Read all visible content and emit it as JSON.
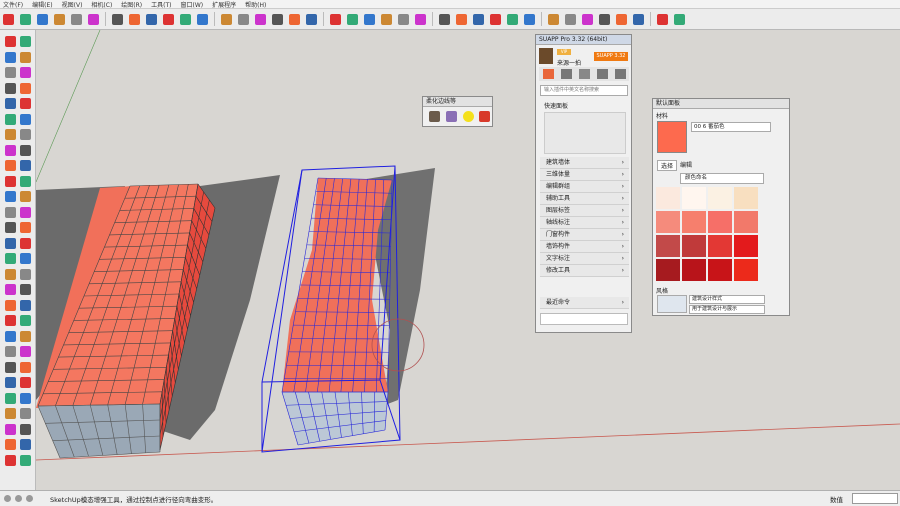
{
  "menubar": {
    "items": [
      "文件(F)",
      "编辑(E)",
      "视图(V)",
      "相机(C)",
      "绘图(R)",
      "工具(T)",
      "窗口(W)",
      "扩展程序",
      "帮助(H)"
    ]
  },
  "toolbar_icons": [
    "select-tool-icon",
    "eraser-icon",
    "line-icon",
    "arc-icon",
    "rectangle-icon",
    "push-pull-icon",
    "move-icon",
    "rotate-icon",
    "scale-icon",
    "offset-icon",
    "tape-measure-icon",
    "text-icon",
    "orbit-icon",
    "pan-icon",
    "zoom-icon",
    "zoom-extents-icon",
    "components-icon",
    "materials-icon",
    "section-plane-icon",
    "display-section-icon",
    "paint-bucket-icon",
    "warehouse-icon",
    "extension-icon",
    "xray-icon",
    "back-edges-icon",
    "wireframe-icon",
    "hidden-line-icon",
    "shaded-icon",
    "shaded-texture-icon",
    "monochrome-icon",
    "iso-view-icon",
    "top-view-icon",
    "front-view-icon",
    "right-view-icon",
    "back-view-icon",
    "left-view-icon",
    "bottom-view-icon",
    "skin-icon"
  ],
  "suapp": {
    "title": "SUAPP Pro 3.32 (64bit)",
    "vip": "VIP",
    "user_name": "来源一拍",
    "version_badge": "SUAPP 3.32",
    "search_placeholder": "输入插件中英文名称搜索",
    "quick_label": "快速面板",
    "categories": [
      "建筑墙体",
      "三维体量",
      "编辑群组",
      "辅助工具",
      "图层标签",
      "轴线标注",
      "门窗构件",
      "墙饰构件",
      "文字标注",
      "修改工具"
    ],
    "recent_label": "最近命令"
  },
  "softpanel": {
    "title": "柔化边线等"
  },
  "materials": {
    "title": "默认面板",
    "section": "材料",
    "material_name": "00 6 番茄色",
    "tab_select": "选择",
    "tab_edit": "编辑",
    "collection": "颜色命名",
    "swatches": [
      "#fbe9de",
      "#fff6ef",
      "#fbf1e3",
      "#f8dfc0",
      "#f58b7c",
      "#f67f6d",
      "#f66f68",
      "#f2796a",
      "#c24a49",
      "#c03a3a",
      "#e33834",
      "#e31a1c",
      "#a61b1f",
      "#b8141a",
      "#c81418",
      "#ec2a1b"
    ],
    "styles_label": "风格",
    "style_name": "建筑设计样式",
    "style_desc": "用于建筑设计与展示"
  },
  "status": {
    "text": "SketchUp模态增强工具，通过控制点进行径向弯曲变形。",
    "measure_label": "数值"
  },
  "colors": {
    "accent": "#e24030",
    "selection": "#1f1fe0"
  }
}
